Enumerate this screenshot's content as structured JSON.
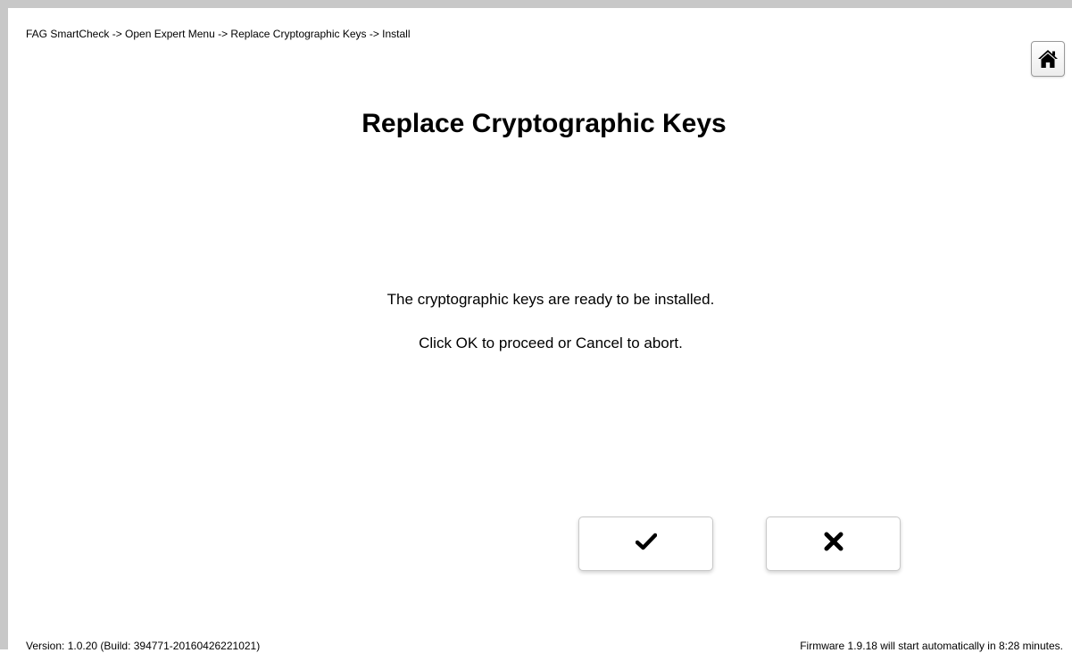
{
  "breadcrumb": {
    "text": "FAG SmartCheck -> Open Expert Menu -> Replace Cryptographic Keys -> Install"
  },
  "header": {
    "home_icon": "home-icon"
  },
  "main": {
    "title": "Replace Cryptographic Keys",
    "message_line1": "The cryptographic keys are ready to be installed.",
    "message_line2": "Click OK to proceed or Cancel to abort."
  },
  "actions": {
    "ok_icon": "checkmark-icon",
    "cancel_icon": "x-icon"
  },
  "footer": {
    "version": "Version: 1.0.20 (Build: 394771-20160426221021)",
    "firmware_notice": "Firmware 1.9.18 will start automatically in 8:28 minutes."
  },
  "colors": {
    "frame_border": "#c8c8c8",
    "text": "#000000",
    "background": "#ffffff"
  }
}
